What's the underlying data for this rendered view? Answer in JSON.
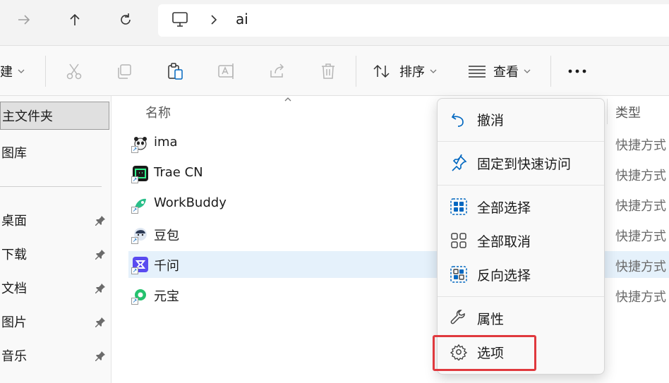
{
  "address": {
    "path_segment": "ai"
  },
  "commandbar": {
    "new_partial": "建",
    "sort_label": "排序",
    "view_label": "查看"
  },
  "sidebar": {
    "items": [
      {
        "label": "主文件夹",
        "pinned": false,
        "selected": true
      },
      {
        "label": "图库",
        "pinned": false,
        "selected": false
      },
      {
        "label": "桌面",
        "pinned": true
      },
      {
        "label": "下载",
        "pinned": true
      },
      {
        "label": "文档",
        "pinned": true
      },
      {
        "label": "图片",
        "pinned": true
      },
      {
        "label": "音乐",
        "pinned": true
      }
    ]
  },
  "filelist": {
    "columns": {
      "name": "名称",
      "type": "类型"
    },
    "rows": [
      {
        "name": "ima",
        "type": "快捷方式",
        "icon": "panda-icon"
      },
      {
        "name": "Trae CN",
        "type": "快捷方式",
        "icon": "trae-icon"
      },
      {
        "name": "WorkBuddy",
        "type": "快捷方式",
        "icon": "workbuddy-icon"
      },
      {
        "name": "豆包",
        "type": "快捷方式",
        "icon": "doubao-icon"
      },
      {
        "name": "千问",
        "type": "快捷方式",
        "icon": "qianwen-icon",
        "selected": true
      },
      {
        "name": "元宝",
        "type": "快捷方式",
        "icon": "yuanbao-icon"
      }
    ]
  },
  "context_menu": {
    "items": [
      {
        "label": "撤消",
        "icon": "undo-icon"
      },
      {
        "label": "固定到快速访问",
        "icon": "pin-icon"
      },
      {
        "label": "全部选择",
        "icon": "select-all-icon"
      },
      {
        "label": "全部取消",
        "icon": "select-none-icon"
      },
      {
        "label": "反向选择",
        "icon": "invert-selection-icon"
      },
      {
        "label": "属性",
        "icon": "wrench-icon"
      },
      {
        "label": "选项",
        "icon": "gear-icon"
      }
    ]
  },
  "colors": {
    "accent": "#0067c0",
    "highlight_box": "#e0393e",
    "selected_row": "#e5f1fb"
  }
}
